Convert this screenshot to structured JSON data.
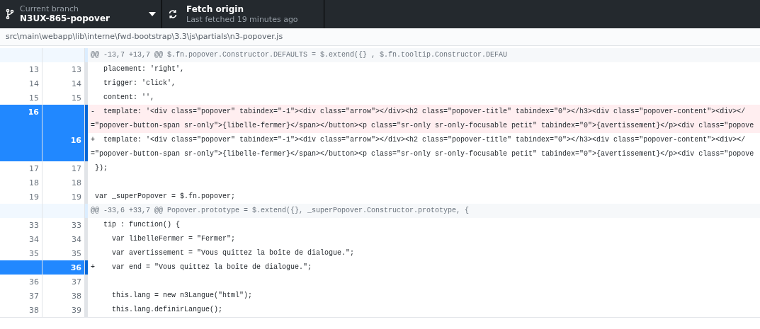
{
  "toolbar": {
    "branch": {
      "label": "Current branch",
      "name": "N3UX-865-popover"
    },
    "fetch": {
      "title": "Fetch origin",
      "subtitle": "Last fetched 19 minutes ago"
    }
  },
  "file_path": "src\\main\\webapp\\lib\\interne\\fwd-bootstrap\\3.3\\js\\partials\\n3-popover.js",
  "rows": [
    {
      "kind": "hunk",
      "selected": false,
      "lines": [
        "@@ -13,7 +13,7 @@ $.fn.popover.Constructor.DEFAULTS = $.extend({} , $.fn.tooltip.Constructor.DEFAU"
      ]
    },
    {
      "kind": "context",
      "old": "13",
      "new": "13",
      "selected": false,
      "lines": [
        "   placement: 'right',"
      ]
    },
    {
      "kind": "context",
      "old": "14",
      "new": "14",
      "selected": false,
      "lines": [
        "   trigger: 'click',"
      ]
    },
    {
      "kind": "context",
      "old": "15",
      "new": "15",
      "selected": false,
      "lines": [
        "   content: '',"
      ]
    },
    {
      "kind": "deleted",
      "old": "16",
      "selected": true,
      "lines": [
        "-  template: '<div class=\"popover\" tabindex=\"-1\"><div class=\"arrow\"></div><h2 class=\"popover-title\" tabindex=\"0\"></h3><div class=\"popover-content\"><div></",
        "=\"popover-button-span sr-only\">{libelle-fermer}</span></button><p class=\"sr-only sr-only-focusable petit\" tabindex=\"0\">{avertissement}</p><div class=\"popove"
      ]
    },
    {
      "kind": "added",
      "new": "16",
      "selected": true,
      "lines": [
        "+  template: '<div class=\"popover\" tabindex=\"-1\"><div class=\"arrow\"></div><h2 class=\"popover-title\" tabindex=\"0\"></h3><div class=\"popover-content\"><div></",
        "=\"popover-button-span sr-only\">{libelle-fermer}</span></button><p class=\"sr-only sr-only-focusable petit\" tabindex=\"0\">{avertissement}</p><div class=\"popove"
      ]
    },
    {
      "kind": "context",
      "old": "17",
      "new": "17",
      "selected": false,
      "lines": [
        " });"
      ]
    },
    {
      "kind": "context",
      "old": "18",
      "new": "18",
      "selected": false
    },
    {
      "kind": "context",
      "old": "19",
      "new": "19",
      "selected": false,
      "lines": [
        " var _superPopover = $.fn.popover;"
      ]
    },
    {
      "kind": "hunk",
      "selected": false,
      "lines": [
        "@@ -33,6 +33,7 @@ Popover.prototype = $.extend({}, _superPopover.Constructor.prototype, {"
      ]
    },
    {
      "kind": "context",
      "old": "33",
      "new": "33",
      "selected": false,
      "lines": [
        "   tip : function() {"
      ]
    },
    {
      "kind": "context",
      "old": "34",
      "new": "34",
      "selected": false,
      "lines": [
        "     var libelleFermer = \"Fermer\";"
      ]
    },
    {
      "kind": "context",
      "old": "35",
      "new": "35",
      "selected": false,
      "lines": [
        "     var avertissement = \"Vous quittez la boîte de dialogue.\";"
      ]
    },
    {
      "kind": "added",
      "new": "36",
      "selected": true,
      "lines": [
        "+    var end = \"Vous quittez la boîte de dialogue.\";"
      ]
    },
    {
      "kind": "context",
      "old": "36",
      "new": "37",
      "selected": false
    },
    {
      "kind": "context",
      "old": "37",
      "new": "38",
      "selected": false,
      "lines": [
        "     this.lang = new n3Langue(\"html\");"
      ]
    },
    {
      "kind": "context",
      "old": "38",
      "new": "39",
      "selected": false,
      "lines": [
        "     this.lang.definirLangue();"
      ]
    }
  ]
}
